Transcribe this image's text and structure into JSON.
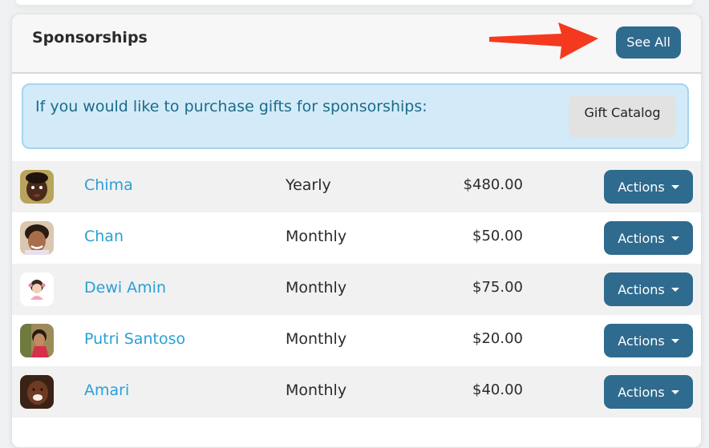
{
  "panel": {
    "title": "Sponsorships",
    "see_all_label": "See All"
  },
  "gift_banner": {
    "text": "If you would like to purchase gifts for sponsorships:",
    "button_label": "Gift Catalog"
  },
  "sponsorships": [
    {
      "name": "Chima",
      "frequency": "Yearly",
      "amount": "$480.00",
      "actions_label": "Actions"
    },
    {
      "name": "Chan",
      "frequency": "Monthly",
      "amount": "$50.00",
      "actions_label": "Actions"
    },
    {
      "name": "Dewi Amin",
      "frequency": "Monthly",
      "amount": "$75.00",
      "actions_label": "Actions"
    },
    {
      "name": "Putri Santoso",
      "frequency": "Monthly",
      "amount": "$20.00",
      "actions_label": "Actions"
    },
    {
      "name": "Amari",
      "frequency": "Monthly",
      "amount": "$40.00",
      "actions_label": "Actions"
    }
  ],
  "colors": {
    "primary_button": "#2f6b8e",
    "link": "#2a9fd6",
    "banner_bg": "#d3ebf8",
    "annotation_arrow": "#f5391e"
  }
}
